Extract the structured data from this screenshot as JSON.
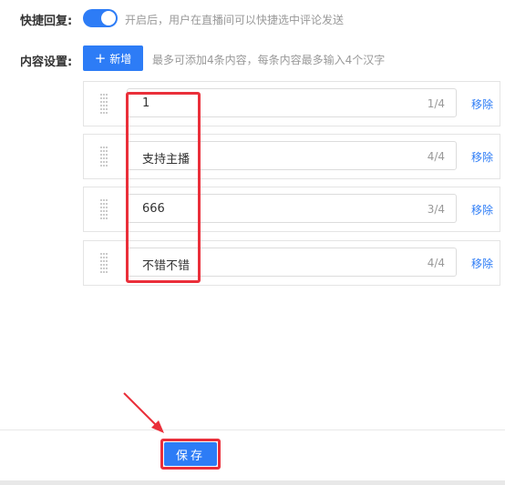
{
  "quick_reply": {
    "label": "快捷回复:",
    "enabled": true,
    "hint": "开启后，用户在直播间可以快捷选中评论发送"
  },
  "content_settings": {
    "label": "内容设置:",
    "add_button": "新增",
    "add_icon": "plus-icon",
    "hint": "最多可添加4条内容，每条内容最多输入4个汉字"
  },
  "items": [
    {
      "value": "1",
      "count": "1/4",
      "remove": "移除"
    },
    {
      "value": "支持主播",
      "count": "4/4",
      "remove": "移除"
    },
    {
      "value": "666",
      "count": "3/4",
      "remove": "移除"
    },
    {
      "value": "不错不错",
      "count": "4/4",
      "remove": "移除"
    }
  ],
  "footer": {
    "save": "保存"
  },
  "colors": {
    "primary": "#2d7cf6",
    "annotation": "#ea2f3a"
  }
}
